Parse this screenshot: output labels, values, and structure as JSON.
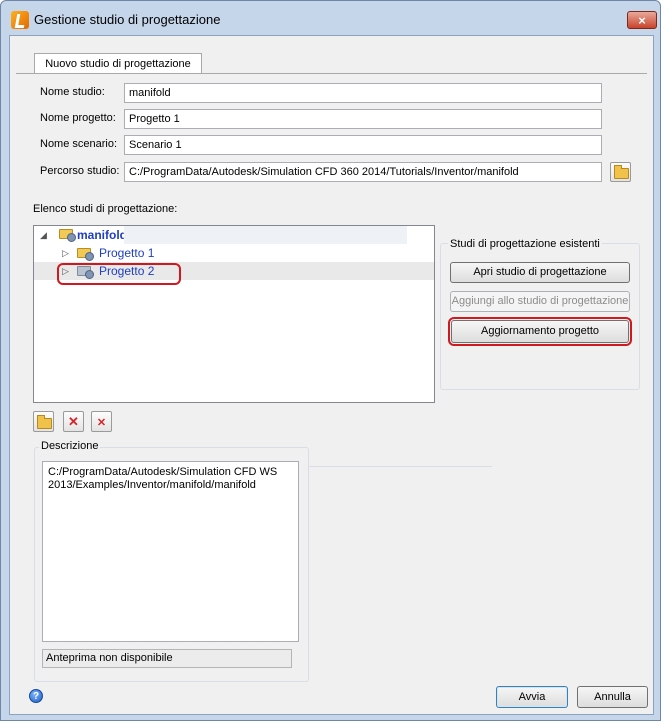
{
  "window": {
    "title": "Gestione studio di progettazione",
    "close_label": "×"
  },
  "tab": {
    "label": "Nuovo studio di progettazione"
  },
  "form": {
    "study_name_label": "Nome studio:",
    "study_name_value": "manifold",
    "project_name_label": "Nome progetto:",
    "project_name_value": "Progetto 1",
    "scenario_name_label": "Nome scenario:",
    "scenario_name_value": "Scenario 1",
    "study_path_label": "Percorso studio:",
    "study_path_value": "C:/ProgramData/Autodesk/Simulation CFD 360 2014/Tutorials/Inventor/manifold"
  },
  "tree": {
    "heading": "Elenco studi di progettazione:",
    "root_label": "manifold",
    "items": [
      {
        "label": "Progetto 1"
      },
      {
        "label": "Progetto 2"
      }
    ]
  },
  "existing": {
    "title": "Studi di progettazione esistenti",
    "open_label": "Apri studio di progettazione",
    "add_label": "Aggiungi allo studio di progettazione",
    "update_label": "Aggiornamento progetto"
  },
  "description": {
    "title": "Descrizione",
    "text_line1": "C:/ProgramData/Autodesk/Simulation CFD WS",
    "text_line2": "2013/Examples/Inventor/manifold/manifold",
    "preview_label": "Anteprima non disponibile"
  },
  "footer": {
    "help_glyph": "?",
    "ok_label": "Avvia",
    "cancel_label": "Annulla"
  },
  "colors": {
    "highlight": "#d0181f",
    "tree_link": "#1f3fbf"
  }
}
